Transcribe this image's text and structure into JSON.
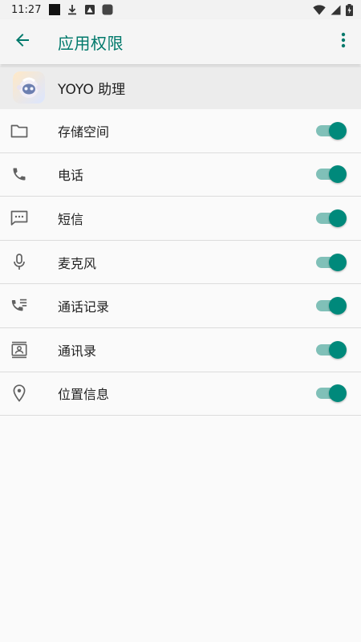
{
  "status_bar": {
    "time": "11:27",
    "notification_icons": [
      "black-square-icon",
      "download-icon",
      "photo-icon",
      "app-icon"
    ],
    "system_icons": [
      "wifi-icon",
      "signal-icon",
      "battery-charging-icon"
    ]
  },
  "app_bar": {
    "title": "应用权限",
    "back_icon": "arrow-back-icon",
    "overflow_icon": "more-vert-icon"
  },
  "app_header": {
    "name": "YOYO 助理",
    "icon": "yoyo-robot-icon"
  },
  "permissions": [
    {
      "label": "存储空间",
      "icon": "folder-icon",
      "enabled": true
    },
    {
      "label": "电话",
      "icon": "phone-icon",
      "enabled": true
    },
    {
      "label": "短信",
      "icon": "sms-icon",
      "enabled": true
    },
    {
      "label": "麦克风",
      "icon": "mic-icon",
      "enabled": true
    },
    {
      "label": "通话记录",
      "icon": "call-log-icon",
      "enabled": true
    },
    {
      "label": "通讯录",
      "icon": "contacts-icon",
      "enabled": true
    },
    {
      "label": "位置信息",
      "icon": "location-icon",
      "enabled": true
    }
  ],
  "colors": {
    "accent": "#00796b",
    "toggle_thumb": "#00897b",
    "toggle_track": "#80c0b8",
    "icon_gray": "#616161"
  }
}
